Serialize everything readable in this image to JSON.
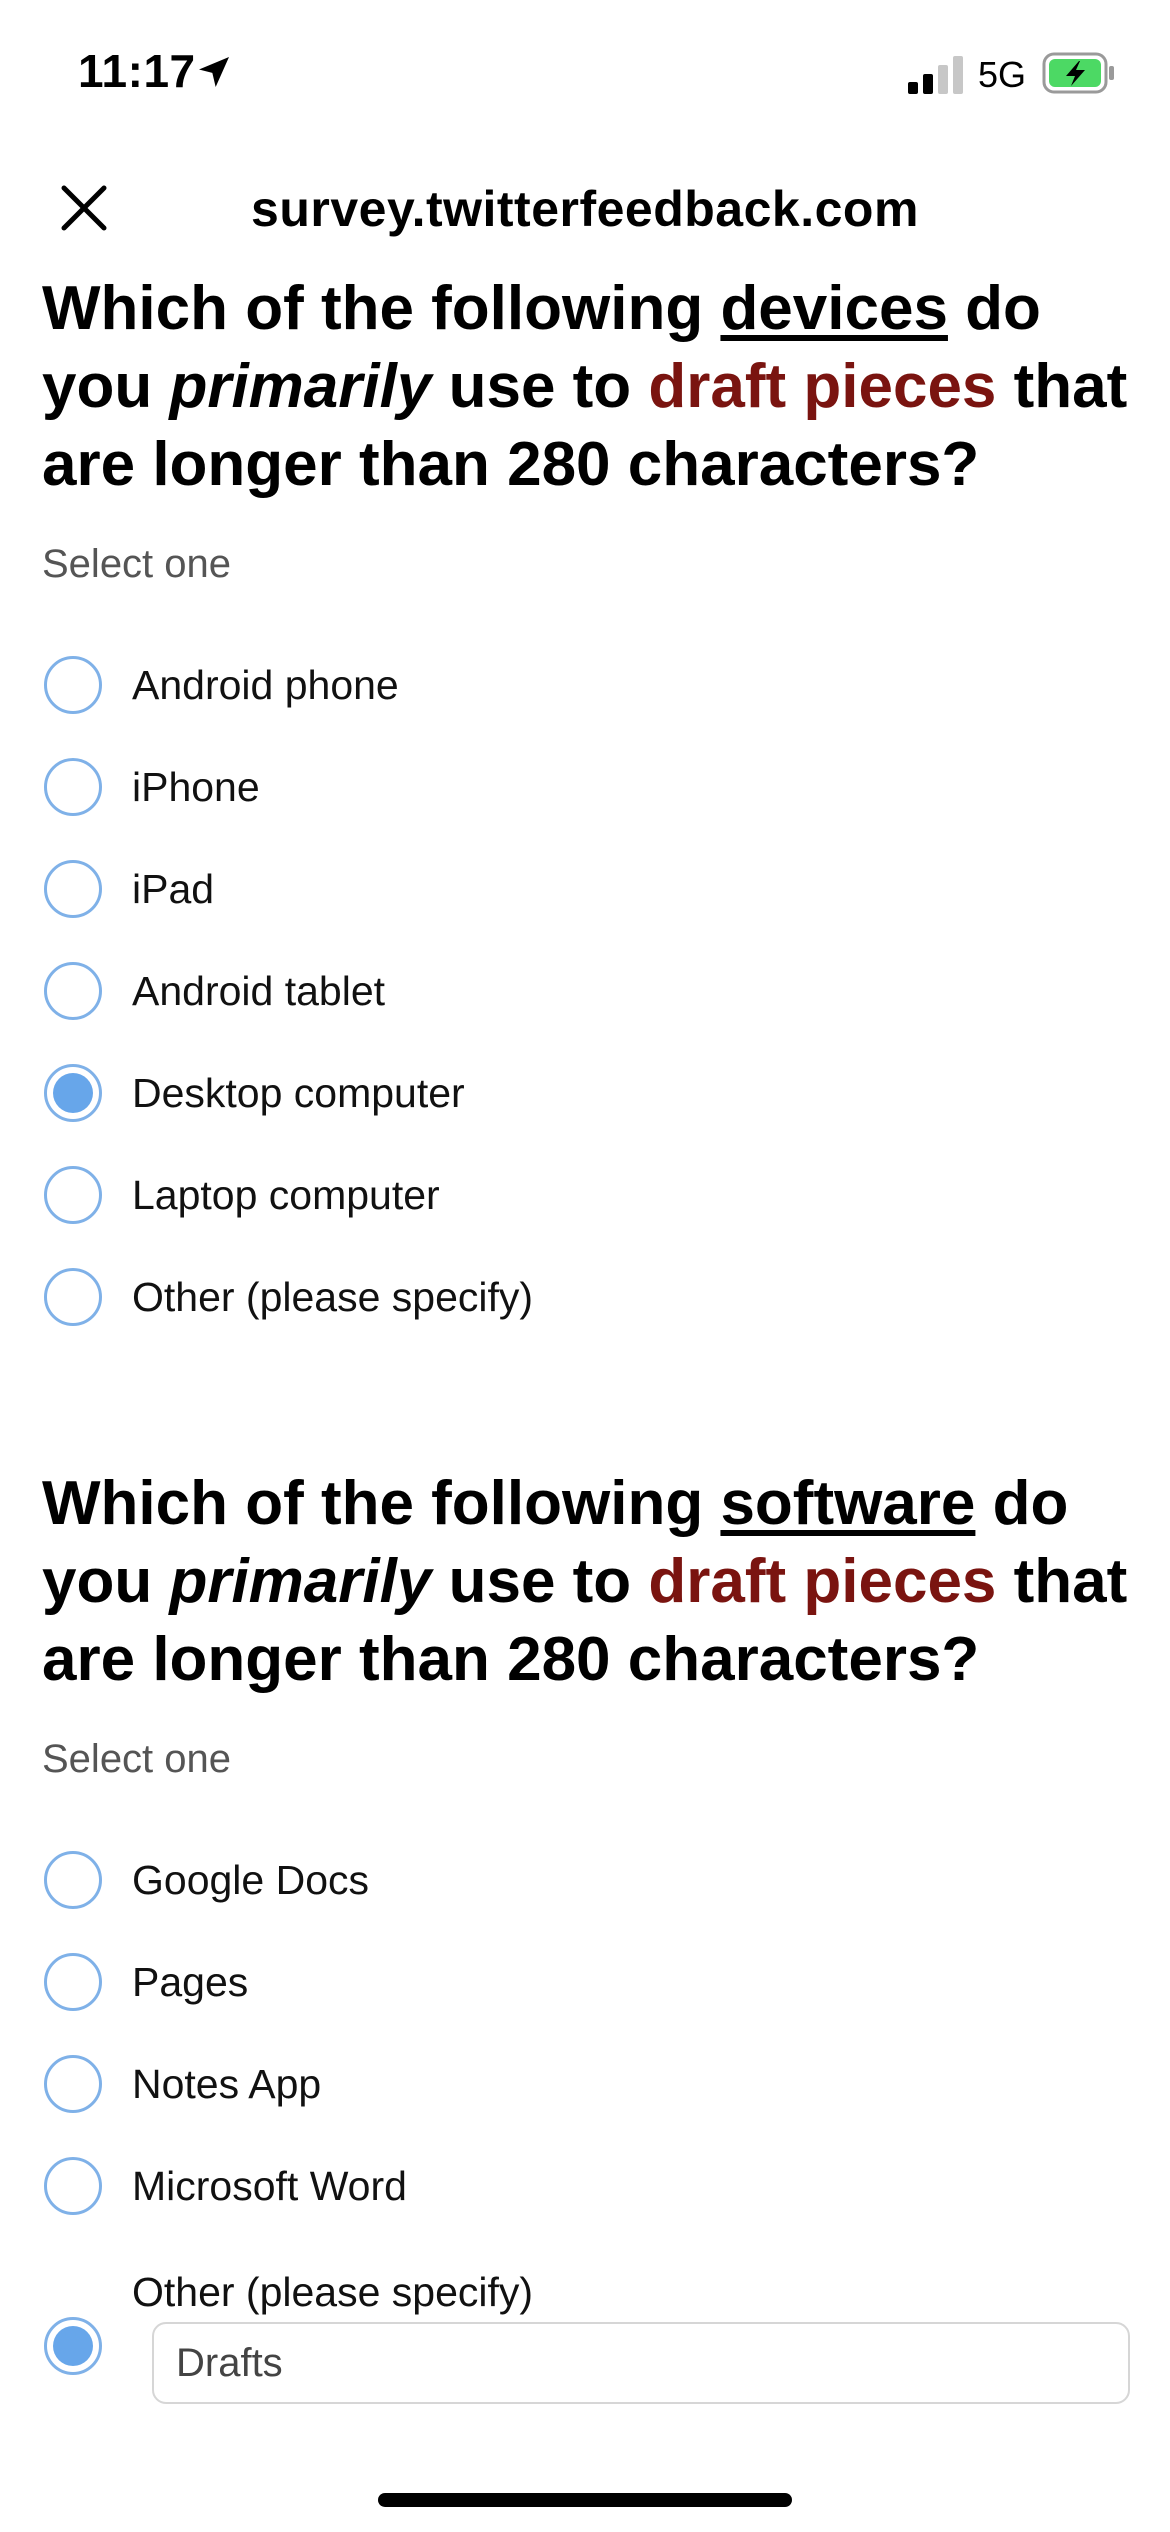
{
  "status_bar": {
    "time": "11:17",
    "network": "5G",
    "icons": [
      "location-arrow-icon",
      "cellular-signal-icon",
      "battery-charging-icon"
    ],
    "battery_color": "#4cd964"
  },
  "nav": {
    "title": "survey.twitterfeedback.com",
    "close_icon": "close-icon"
  },
  "questions": [
    {
      "text_1": "Which of the following ",
      "keyword": "devices",
      "text_2": " do you ",
      "emphasis": "primarily",
      "text_3": " use to ",
      "highlight": "draft pieces",
      "text_4": " that are longer than 280 characters?",
      "hint": "Select one",
      "options": [
        {
          "label": "Android phone",
          "selected": false
        },
        {
          "label": "iPhone",
          "selected": false
        },
        {
          "label": "iPad",
          "selected": false
        },
        {
          "label": "Android tablet",
          "selected": false
        },
        {
          "label": "Desktop computer",
          "selected": true
        },
        {
          "label": "Laptop computer",
          "selected": false
        },
        {
          "label": "Other (please specify)",
          "selected": false
        }
      ]
    },
    {
      "text_1": "Which of the following ",
      "keyword": "software",
      "text_2": " do you ",
      "emphasis": "primarily",
      "text_3": " use to ",
      "highlight": "draft pieces",
      "text_4": " that are longer than 280 characters?",
      "hint": "Select one",
      "options": [
        {
          "label": "Google Docs",
          "selected": false
        },
        {
          "label": "Pages",
          "selected": false
        },
        {
          "label": "Notes App",
          "selected": false
        },
        {
          "label": "Microsoft Word",
          "selected": false
        },
        {
          "label": "Other (please specify)",
          "selected": true
        }
      ],
      "other_value": "Drafts"
    }
  ],
  "colors": {
    "highlight_red": "#7a1410",
    "radio_blue": "#67a6ea",
    "radio_border": "#7fb1e8"
  }
}
